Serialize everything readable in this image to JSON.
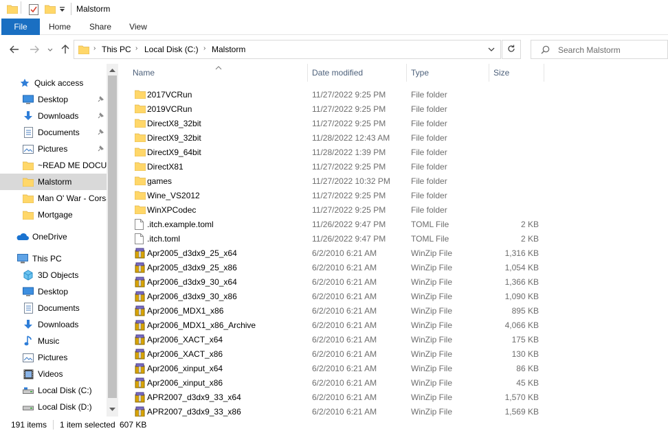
{
  "window": {
    "title": "Malstorm"
  },
  "ribbon": {
    "tabs": [
      "File",
      "Home",
      "Share",
      "View"
    ]
  },
  "address": {
    "crumbs": [
      "This PC",
      "Local Disk (C:)",
      "Malstorm"
    ]
  },
  "search": {
    "placeholder": "Search Malstorm"
  },
  "nav": {
    "quick_access": "Quick access",
    "quick_items": [
      {
        "label": "Desktop",
        "icon": "desktop-icon",
        "pinned": true
      },
      {
        "label": "Downloads",
        "icon": "download-icon",
        "pinned": true
      },
      {
        "label": "Documents",
        "icon": "documents-icon",
        "pinned": true
      },
      {
        "label": "Pictures",
        "icon": "pictures-icon",
        "pinned": true
      },
      {
        "label": "~READ ME DOCUM",
        "icon": "folder-icon",
        "pinned": false
      },
      {
        "label": "Malstorm",
        "icon": "folder-icon",
        "pinned": false,
        "selected": true
      },
      {
        "label": "Man O' War - Corsa",
        "icon": "folder-icon",
        "pinned": false
      },
      {
        "label": "Mortgage",
        "icon": "folder-icon",
        "pinned": false
      }
    ],
    "onedrive": "OneDrive",
    "this_pc": "This PC",
    "pc_items": [
      {
        "label": "3D Objects",
        "icon": "3d-objects-icon"
      },
      {
        "label": "Desktop",
        "icon": "desktop-icon"
      },
      {
        "label": "Documents",
        "icon": "documents-icon"
      },
      {
        "label": "Downloads",
        "icon": "download-icon"
      },
      {
        "label": "Music",
        "icon": "music-icon"
      },
      {
        "label": "Pictures",
        "icon": "pictures-icon"
      },
      {
        "label": "Videos",
        "icon": "videos-icon"
      },
      {
        "label": "Local Disk (C:)",
        "icon": "drive-icon"
      },
      {
        "label": "Local Disk (D:)",
        "icon": "drive-icon"
      }
    ]
  },
  "columns": {
    "name": "Name",
    "date": "Date modified",
    "type": "Type",
    "size": "Size"
  },
  "files": [
    {
      "name": "2017VCRun",
      "date": "11/27/2022 9:25 PM",
      "type": "File folder",
      "size": "",
      "kind": "folder"
    },
    {
      "name": "2019VCRun",
      "date": "11/27/2022 9:25 PM",
      "type": "File folder",
      "size": "",
      "kind": "folder"
    },
    {
      "name": "DirectX8_32bit",
      "date": "11/27/2022 9:25 PM",
      "type": "File folder",
      "size": "",
      "kind": "folder"
    },
    {
      "name": "DirectX9_32bit",
      "date": "11/28/2022 12:43 AM",
      "type": "File folder",
      "size": "",
      "kind": "folder"
    },
    {
      "name": "DirectX9_64bit",
      "date": "11/28/2022 1:39 PM",
      "type": "File folder",
      "size": "",
      "kind": "folder"
    },
    {
      "name": "DirectX81",
      "date": "11/27/2022 9:25 PM",
      "type": "File folder",
      "size": "",
      "kind": "folder"
    },
    {
      "name": "games",
      "date": "11/27/2022 10:32 PM",
      "type": "File folder",
      "size": "",
      "kind": "folder"
    },
    {
      "name": "Wine_VS2012",
      "date": "11/27/2022 9:25 PM",
      "type": "File folder",
      "size": "",
      "kind": "folder"
    },
    {
      "name": "WinXPCodec",
      "date": "11/27/2022 9:25 PM",
      "type": "File folder",
      "size": "",
      "kind": "folder"
    },
    {
      "name": ".itch.example.toml",
      "date": "11/26/2022 9:47 PM",
      "type": "TOML File",
      "size": "2 KB",
      "kind": "file"
    },
    {
      "name": ".itch.toml",
      "date": "11/26/2022 9:47 PM",
      "type": "TOML File",
      "size": "2 KB",
      "kind": "file"
    },
    {
      "name": "Apr2005_d3dx9_25_x64",
      "date": "6/2/2010 6:21 AM",
      "type": "WinZip File",
      "size": "1,316 KB",
      "kind": "zip"
    },
    {
      "name": "Apr2005_d3dx9_25_x86",
      "date": "6/2/2010 6:21 AM",
      "type": "WinZip File",
      "size": "1,054 KB",
      "kind": "zip"
    },
    {
      "name": "Apr2006_d3dx9_30_x64",
      "date": "6/2/2010 6:21 AM",
      "type": "WinZip File",
      "size": "1,366 KB",
      "kind": "zip"
    },
    {
      "name": "Apr2006_d3dx9_30_x86",
      "date": "6/2/2010 6:21 AM",
      "type": "WinZip File",
      "size": "1,090 KB",
      "kind": "zip"
    },
    {
      "name": "Apr2006_MDX1_x86",
      "date": "6/2/2010 6:21 AM",
      "type": "WinZip File",
      "size": "895 KB",
      "kind": "zip"
    },
    {
      "name": "Apr2006_MDX1_x86_Archive",
      "date": "6/2/2010 6:21 AM",
      "type": "WinZip File",
      "size": "4,066 KB",
      "kind": "zip"
    },
    {
      "name": "Apr2006_XACT_x64",
      "date": "6/2/2010 6:21 AM",
      "type": "WinZip File",
      "size": "175 KB",
      "kind": "zip"
    },
    {
      "name": "Apr2006_XACT_x86",
      "date": "6/2/2010 6:21 AM",
      "type": "WinZip File",
      "size": "130 KB",
      "kind": "zip"
    },
    {
      "name": "Apr2006_xinput_x64",
      "date": "6/2/2010 6:21 AM",
      "type": "WinZip File",
      "size": "86 KB",
      "kind": "zip"
    },
    {
      "name": "Apr2006_xinput_x86",
      "date": "6/2/2010 6:21 AM",
      "type": "WinZip File",
      "size": "45 KB",
      "kind": "zip"
    },
    {
      "name": "APR2007_d3dx9_33_x64",
      "date": "6/2/2010 6:21 AM",
      "type": "WinZip File",
      "size": "1,570 KB",
      "kind": "zip"
    },
    {
      "name": "APR2007_d3dx9_33_x86",
      "date": "6/2/2010 6:21 AM",
      "type": "WinZip File",
      "size": "1,569 KB",
      "kind": "zip"
    }
  ],
  "status": {
    "item_count": "191 items",
    "selection": "1 item selected",
    "size": "607 KB"
  },
  "colors": {
    "file_tab": "#1a6fc2",
    "folder": "#ffd769",
    "header_text": "#4c607a",
    "selected_nav": "#d9d9d9"
  }
}
